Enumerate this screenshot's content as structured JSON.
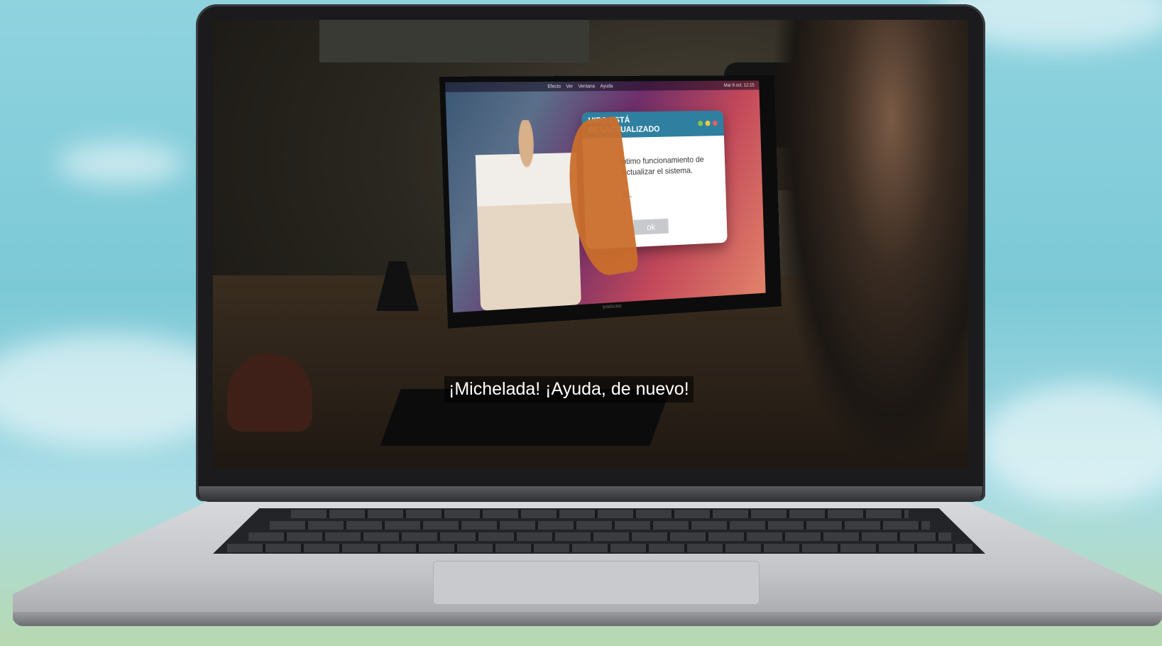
{
  "video": {
    "subtitle": "¡Michelada! ¡Ayuda, de nuevo!"
  },
  "monitor_screen": {
    "menu_items": [
      "Efecto",
      "Ver",
      "Ventana",
      "Ayuda"
    ],
    "status_time": "Mar 8 oct. 12:15",
    "dialog": {
      "title": "UIPO ESTÁ DESACTUALIZADO",
      "line1": "ptimo funcionamiento de",
      "line2": "actualizar el sistema.",
      "line3": "ra.",
      "ok_label": "ok"
    },
    "monitor_brand": "SAMSUNG"
  },
  "colors": {
    "sky": "#8fd3df",
    "dialog_header": "#2f7fa0",
    "dot_green": "#8bc34a",
    "dot_yellow": "#f2c94c",
    "dot_red": "#e35d6a"
  }
}
